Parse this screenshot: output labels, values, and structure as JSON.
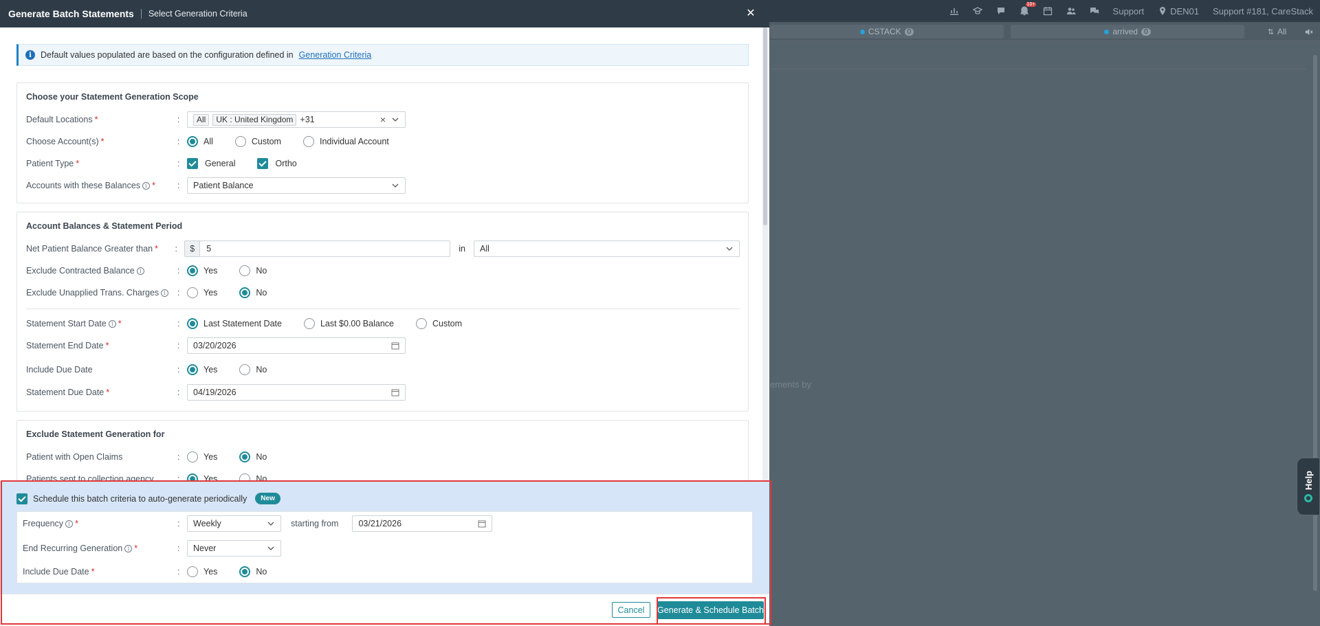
{
  "background": {
    "topbar": {
      "support": "Support",
      "location": "DEN01",
      "user": "Support #181, CareStack",
      "notification_count": "10+"
    },
    "pills": [
      {
        "label": "CSTACK",
        "count": "0"
      },
      {
        "label": "arrived",
        "count": "0"
      }
    ],
    "filter_all": "All",
    "faint_text": "ements by",
    "help_label": "Help"
  },
  "modal": {
    "title": "Generate Batch Statements",
    "subtitle": "Select Generation Criteria",
    "close_icon": "close-icon",
    "info": {
      "text": "Default values populated are based on the configuration defined in",
      "link": "Generation Criteria"
    },
    "scope": {
      "title": "Choose your Statement Generation Scope",
      "locations": {
        "label": "Default Locations",
        "tags": [
          "All",
          "UK : United Kingdom"
        ],
        "more": "+31"
      },
      "accounts": {
        "label": "Choose Account(s)",
        "options": [
          "All",
          "Custom",
          "Individual Account"
        ],
        "selected": "All"
      },
      "patient_type": {
        "label": "Patient Type",
        "options": [
          "General",
          "Ortho"
        ],
        "checked": [
          "General",
          "Ortho"
        ]
      },
      "balances": {
        "label": "Accounts with these Balances",
        "value": "Patient Balance"
      }
    },
    "balances": {
      "title": "Account Balances & Statement Period",
      "net": {
        "label": "Net Patient Balance Greater than",
        "currency": "$",
        "value": "5",
        "in_label": "in",
        "in_value": "All"
      },
      "exclude_contracted": {
        "label": "Exclude Contracted Balance",
        "yes": "Yes",
        "no": "No",
        "selected": "Yes"
      },
      "exclude_unapplied": {
        "label": "Exclude Unapplied Trans. Charges",
        "yes": "Yes",
        "no": "No",
        "selected": "No"
      },
      "start_date": {
        "label": "Statement Start Date",
        "options": [
          "Last Statement Date",
          "Last $0.00 Balance",
          "Custom"
        ],
        "selected": "Last Statement Date"
      },
      "end_date": {
        "label": "Statement End Date",
        "value": "03/20/2026"
      },
      "include_due": {
        "label": "Include Due Date",
        "yes": "Yes",
        "no": "No",
        "selected": "Yes"
      },
      "due_date": {
        "label": "Statement Due Date",
        "value": "04/19/2026"
      }
    },
    "exclude": {
      "title": "Exclude Statement Generation for",
      "open_claims": {
        "label": "Patient with Open Claims",
        "yes": "Yes",
        "no": "No",
        "selected": "No"
      },
      "collection": {
        "label": "Patients sent to collection agency",
        "yes": "Yes",
        "no": "No",
        "selected": "Yes"
      }
    },
    "schedule": {
      "checkbox_label": "Schedule this batch criteria to auto-generate periodically",
      "badge": "New",
      "frequency": {
        "label": "Frequency",
        "value": "Weekly",
        "starting_label": "starting from",
        "starting_value": "03/21/2026"
      },
      "end_recurring": {
        "label": "End Recurring Generation",
        "value": "Never"
      },
      "include_due": {
        "label": "Include Due Date",
        "yes": "Yes",
        "no": "No",
        "selected": "No"
      }
    },
    "footer": {
      "cancel": "Cancel",
      "generate": "Generate & Schedule Batch"
    }
  },
  "colors": {
    "accent": "#1f8b99",
    "header": "#2f3c47",
    "highlight": "#e0373a",
    "schedule_bg": "#d6e5f7"
  }
}
